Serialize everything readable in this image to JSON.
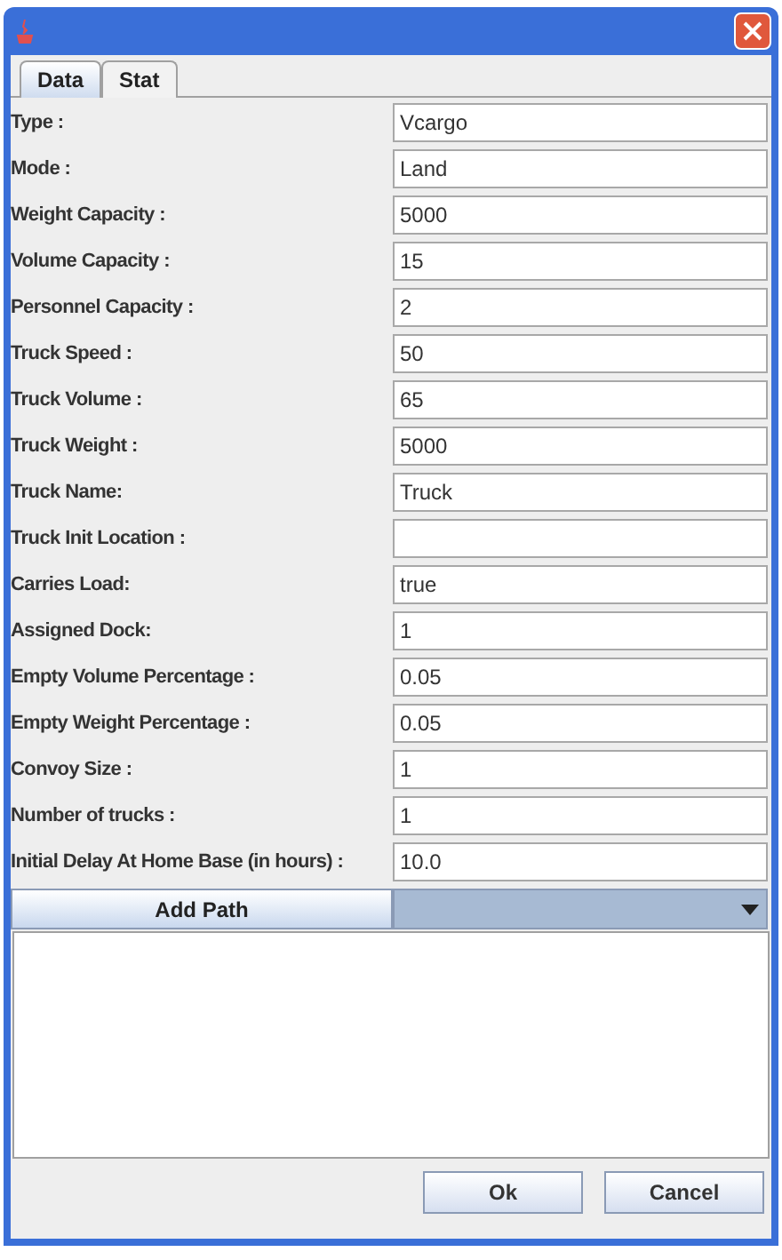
{
  "tabs": [
    {
      "label": "Data",
      "selected": true
    },
    {
      "label": "Stat",
      "selected": false
    }
  ],
  "fields": [
    {
      "label": "Type :",
      "value": "Vcargo"
    },
    {
      "label": "Mode :",
      "value": "Land"
    },
    {
      "label": "Weight Capacity :",
      "value": "5000"
    },
    {
      "label": "Volume Capacity :",
      "value": "15"
    },
    {
      "label": "Personnel Capacity :",
      "value": "2"
    },
    {
      "label": "Truck Speed :",
      "value": "50"
    },
    {
      "label": "Truck Volume :",
      "value": "65"
    },
    {
      "label": "Truck Weight :",
      "value": "5000"
    },
    {
      "label": "Truck Name:",
      "value": "Truck"
    },
    {
      "label": "Truck Init Location :"
    },
    {
      "label": "Carries Load:",
      "value": "true"
    },
    {
      "label": "Assigned Dock:",
      "value": "1"
    },
    {
      "label": "Empty Volume Percentage  :",
      "value": "0.05"
    },
    {
      "label": "Empty Weight Percentage  :",
      "value": "0.05"
    },
    {
      "label": "Convoy Size  :",
      "value": "1"
    },
    {
      "label": "Number of trucks  :",
      "value": "1"
    },
    {
      "label": "Initial Delay At Home Base (in hours) :",
      "value": "10.0"
    }
  ],
  "add_path_button": "Add Path",
  "buttons": [
    "Ok",
    "Cancel"
  ]
}
